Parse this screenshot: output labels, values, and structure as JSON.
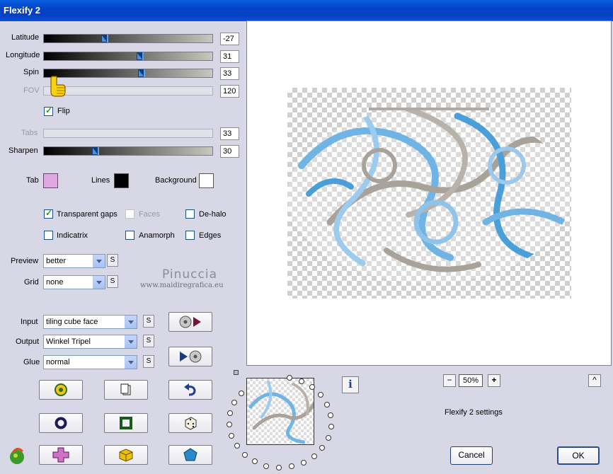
{
  "window": {
    "title": "Flexify 2"
  },
  "sliders": {
    "latitude": {
      "label": "Latitude",
      "value": "-27",
      "position": 0.36,
      "enabled": true
    },
    "longitude": {
      "label": "Longitude",
      "value": "31",
      "position": 0.58,
      "enabled": true
    },
    "spin": {
      "label": "Spin",
      "value": "33",
      "position": 0.59,
      "enabled": true
    },
    "fov": {
      "label": "FOV",
      "value": "120",
      "position": 0.0,
      "enabled": false
    },
    "tabs": {
      "label": "Tabs",
      "value": "33",
      "position": 0.0,
      "enabled": false
    },
    "sharpen": {
      "label": "Sharpen",
      "value": "30",
      "position": 0.3,
      "enabled": true
    }
  },
  "flip": {
    "label": "Flip",
    "checked": true
  },
  "colors": {
    "tab": {
      "label": "Tab",
      "color": "#e0a8e0"
    },
    "lines": {
      "label": "Lines",
      "color": "#000000"
    },
    "background": {
      "label": "Background",
      "color": "#ffffff"
    }
  },
  "options": {
    "transparent_gaps": {
      "label": "Transparent gaps",
      "checked": true
    },
    "faces": {
      "label": "Faces",
      "checked": false,
      "enabled": false
    },
    "de_halo": {
      "label": "De-halo",
      "checked": false
    },
    "indicatrix": {
      "label": "Indicatrix",
      "checked": false
    },
    "anamorph": {
      "label": "Anamorph",
      "checked": false
    },
    "edges": {
      "label": "Edges",
      "checked": false
    }
  },
  "selects": {
    "preview": {
      "label": "Preview",
      "value": "better"
    },
    "grid": {
      "label": "Grid",
      "value": "none"
    },
    "input": {
      "label": "Input",
      "value": "tiling cube face"
    },
    "output": {
      "label": "Output",
      "value": "Winkel Tripel"
    },
    "glue": {
      "label": "Glue",
      "value": "normal"
    }
  },
  "s_button_label": "S",
  "watermark": {
    "name": "Pinuccia",
    "url": "www.maidiregrafica.eu"
  },
  "zoom": {
    "value": "50%",
    "minus": "−",
    "plus": "+",
    "up": "^"
  },
  "settings_label": "Flexify 2 settings",
  "buttons": {
    "cancel": "Cancel",
    "ok": "OK"
  },
  "info_icon_glyph": "i",
  "icon_names": [
    "input-to-output-icon",
    "output-to-input-icon",
    "randomize-icon",
    "copy-icon",
    "undo-icon",
    "ring-icon",
    "square-frame-icon",
    "dice-icon",
    "flexify-logo-icon",
    "cross-shape-icon",
    "cube-icon",
    "pentagon-icon"
  ]
}
